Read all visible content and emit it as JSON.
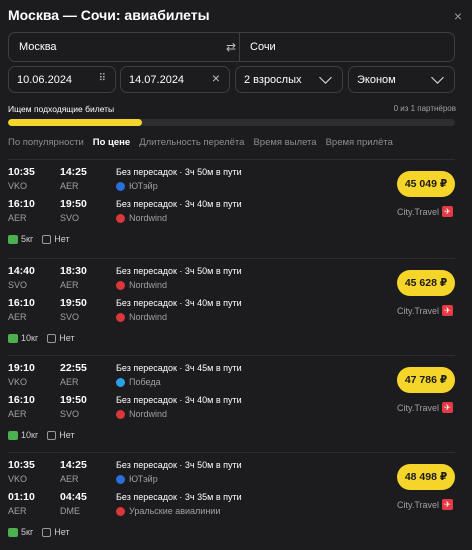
{
  "header": {
    "title": "Москва — Сочи: авиабилеты",
    "close_glyph": "×"
  },
  "search": {
    "from": "Москва",
    "to": "Сочи",
    "depart_date": "10.06.2024",
    "return_date": "14.07.2024",
    "passengers": "2 взрослых",
    "cabin": "Эконом"
  },
  "status": {
    "label": "Ищем подходящие билеты",
    "partners": "0 из 1 партнёров",
    "progress": 0.3
  },
  "sort_tabs": [
    "По популярности",
    "По цене",
    "Длительность перелёта",
    "Время вылета",
    "Время прилёта"
  ],
  "sort_active_index": 1,
  "offers": [
    {
      "price": "45 049 ₽",
      "seller": "City.Travel",
      "baggage": "5кг",
      "carry_on": "Нет",
      "legs": [
        {
          "dep_time": "10:35",
          "arr_time": "14:25",
          "dep_code": "VKO",
          "arr_code": "AER",
          "info": "Без пересадок · 3ч 50м в пути",
          "airline": "ЮТэйр",
          "airline_color": "#2a6fd8"
        },
        {
          "dep_time": "16:10",
          "arr_time": "19:50",
          "dep_code": "AER",
          "arr_code": "SVO",
          "info": "Без пересадок · 3ч 40м в пути",
          "airline": "Nordwind",
          "airline_color": "#d9373a"
        }
      ]
    },
    {
      "price": "45 628 ₽",
      "seller": "City.Travel",
      "baggage": "10кг",
      "carry_on": "Нет",
      "legs": [
        {
          "dep_time": "14:40",
          "arr_time": "18:30",
          "dep_code": "SVO",
          "arr_code": "AER",
          "info": "Без пересадок · 3ч 50м в пути",
          "airline": "Nordwind",
          "airline_color": "#d9373a"
        },
        {
          "dep_time": "16:10",
          "arr_time": "19:50",
          "dep_code": "AER",
          "arr_code": "SVO",
          "info": "Без пересадок · 3ч 40м в пути",
          "airline": "Nordwind",
          "airline_color": "#d9373a"
        }
      ]
    },
    {
      "price": "47 786 ₽",
      "seller": "City.Travel",
      "baggage": "10кг",
      "carry_on": "Нет",
      "legs": [
        {
          "dep_time": "19:10",
          "arr_time": "22:55",
          "dep_code": "VKO",
          "arr_code": "AER",
          "info": "Без пересадок · 3ч 45м в пути",
          "airline": "Победа",
          "airline_color": "#2aa0e6"
        },
        {
          "dep_time": "16:10",
          "arr_time": "19:50",
          "dep_code": "AER",
          "arr_code": "SVO",
          "info": "Без пересадок · 3ч 40м в пути",
          "airline": "Nordwind",
          "airline_color": "#d9373a"
        }
      ]
    },
    {
      "price": "48 498 ₽",
      "seller": "City.Travel",
      "baggage": "5кг",
      "carry_on": "Нет",
      "legs": [
        {
          "dep_time": "10:35",
          "arr_time": "14:25",
          "dep_code": "VKO",
          "arr_code": "AER",
          "info": "Без пересадок · 3ч 50м в пути",
          "airline": "ЮТэйр",
          "airline_color": "#2a6fd8"
        },
        {
          "dep_time": "01:10",
          "arr_time": "04:45",
          "dep_code": "AER",
          "arr_code": "DME",
          "info": "Без пересадок · 3ч 35м в пути",
          "airline": "Уральские авиалинии",
          "airline_color": "#d9373a"
        }
      ]
    }
  ],
  "colors": {
    "accent": "#f6d52b",
    "background": "#1c1c1e",
    "baggage": "#4caf50"
  }
}
